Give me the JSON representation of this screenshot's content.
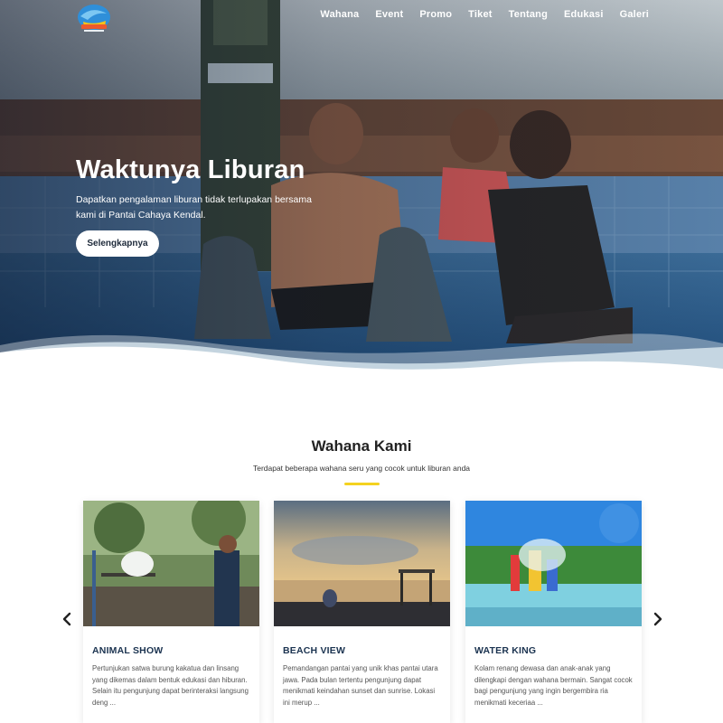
{
  "header": {
    "logo_icon": "dolphin-logo-icon",
    "nav": [
      {
        "label": "Wahana"
      },
      {
        "label": "Event"
      },
      {
        "label": "Promo"
      },
      {
        "label": "Tiket"
      },
      {
        "label": "Tentang"
      },
      {
        "label": "Edukasi"
      },
      {
        "label": "Galeri"
      }
    ]
  },
  "hero": {
    "title": "Waktunya Liburan",
    "description": "Dapatkan pengalaman liburan tidak terlupakan bersama kami di Pantai Cahaya Kendal.",
    "button_label": "Selengkapnya"
  },
  "wahana": {
    "title": "Wahana Kami",
    "subtitle": "Terdapat beberapa wahana seru yang cocok untuk liburan anda",
    "accent_color": "#f4d21f",
    "cards": [
      {
        "title": "ANIMAL SHOW",
        "description": "Pertunjukan satwa burung kakatua dan linsang yang dikemas dalam bentuk edukasi dan hiburan. Selain itu pengunjung dapat berinteraksi langsung deng ..."
      },
      {
        "title": "BEACH VIEW",
        "description": "Pemandangan pantai yang unik khas pantai utara jawa. Pada bulan tertentu pengunjung dapat menikmati keindahan sunset dan sunrise. Lokasi ini merup ..."
      },
      {
        "title": "WATER KING",
        "description": "Kolam renang dewasa dan anak-anak yang dilengkapi dengan wahana bermain. Sangat cocok bagi pengunjung yang ingin bergembira ria menikmati keceriaa ..."
      }
    ],
    "prev_icon": "chevron-left-icon",
    "next_icon": "chevron-right-icon"
  }
}
